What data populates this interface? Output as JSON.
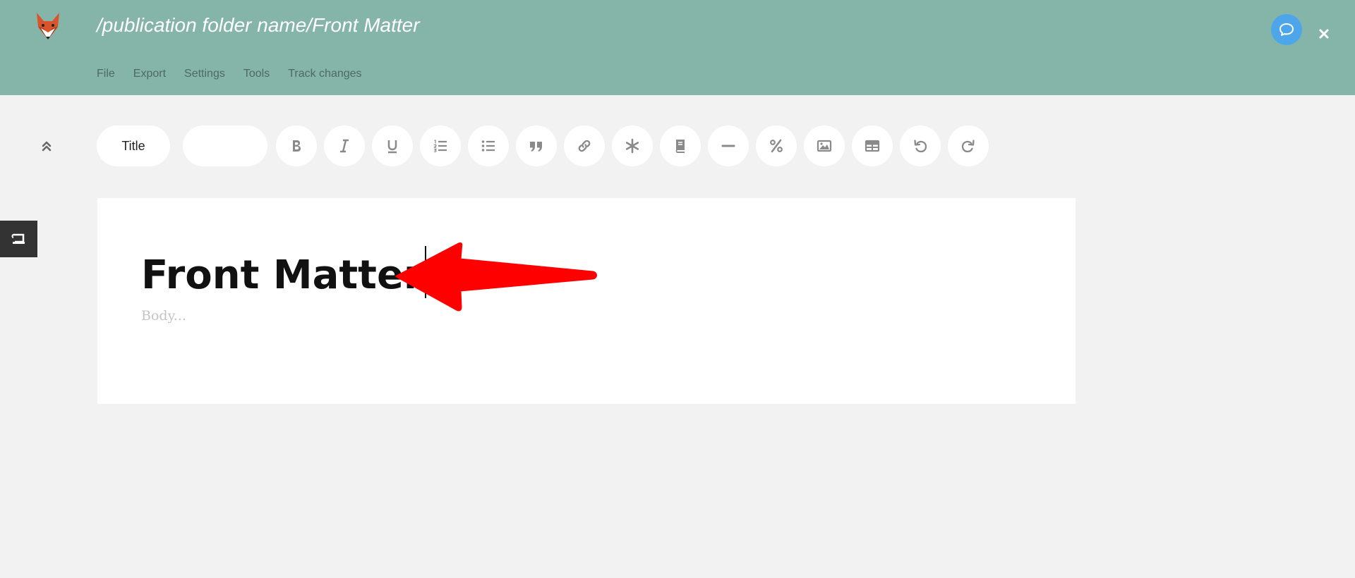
{
  "header": {
    "path": "/publication folder name/Front Matter",
    "menu": [
      "File",
      "Export",
      "Settings",
      "Tools",
      "Track changes"
    ],
    "logo_icon": "fox-logo-icon",
    "chat_icon": "chat-bubble-icon",
    "close_icon": "close-icon",
    "background_color": "#85b4a9"
  },
  "toolbar": {
    "block_style": "Title",
    "secondary_style": "",
    "buttons": [
      {
        "name": "bold",
        "icon": "bold-icon"
      },
      {
        "name": "italic",
        "icon": "italic-icon"
      },
      {
        "name": "underline",
        "icon": "underline-icon"
      },
      {
        "name": "numbered-list",
        "icon": "numbered-list-icon"
      },
      {
        "name": "bullet-list",
        "icon": "bullet-list-icon"
      },
      {
        "name": "blockquote",
        "icon": "quote-icon"
      },
      {
        "name": "link",
        "icon": "link-icon"
      },
      {
        "name": "footnote",
        "icon": "asterisk-icon"
      },
      {
        "name": "citation",
        "icon": "book-icon"
      },
      {
        "name": "horizontal-rule",
        "icon": "minus-icon"
      },
      {
        "name": "formula",
        "icon": "percent-icon"
      },
      {
        "name": "figure",
        "icon": "image-icon"
      },
      {
        "name": "table",
        "icon": "table-icon"
      },
      {
        "name": "undo",
        "icon": "undo-icon"
      },
      {
        "name": "redo",
        "icon": "redo-icon"
      }
    ]
  },
  "document": {
    "title": "Front Matter",
    "body_placeholder": "Body..."
  },
  "annotation": {
    "arrow_color": "#ff0000"
  }
}
